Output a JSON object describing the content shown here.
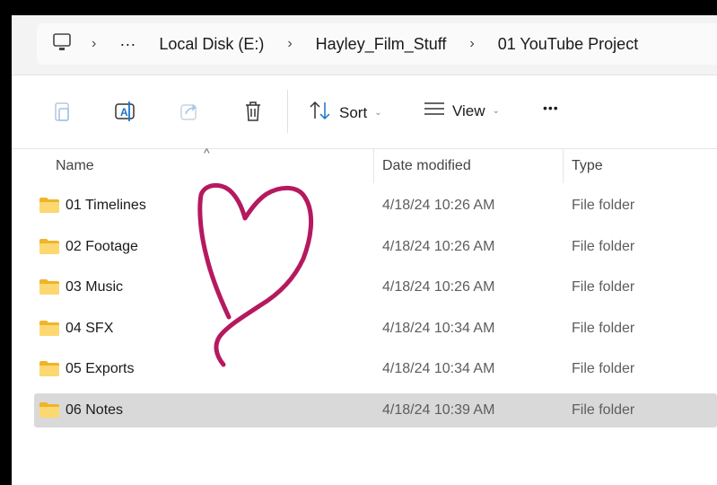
{
  "breadcrumb": {
    "items": [
      "Local Disk (E:)",
      "Hayley_Film_Stuff",
      "01 YouTube Project"
    ],
    "overflow": "···"
  },
  "toolbar": {
    "sort_label": "Sort",
    "view_label": "View",
    "more_label": "•••"
  },
  "columns": {
    "name": "Name",
    "date": "Date modified",
    "type": "Type"
  },
  "files": [
    {
      "name": "01 Timelines",
      "date": "4/18/24 10:26 AM",
      "type": "File folder"
    },
    {
      "name": "02 Footage",
      "date": "4/18/24 10:26 AM",
      "type": "File folder"
    },
    {
      "name": "03 Music",
      "date": "4/18/24 10:26 AM",
      "type": "File folder"
    },
    {
      "name": "04 SFX",
      "date": "4/18/24 10:34 AM",
      "type": "File folder"
    },
    {
      "name": "05 Exports",
      "date": "4/18/24 10:34 AM",
      "type": "File folder"
    },
    {
      "name": "06 Notes",
      "date": "4/18/24 10:39 AM",
      "type": "File folder"
    }
  ],
  "selected_index": 5,
  "colors": {
    "heart": "#b5195f",
    "accent": "#1a73c9",
    "folder": "#f7c948",
    "selected": "#d9d9d9"
  }
}
